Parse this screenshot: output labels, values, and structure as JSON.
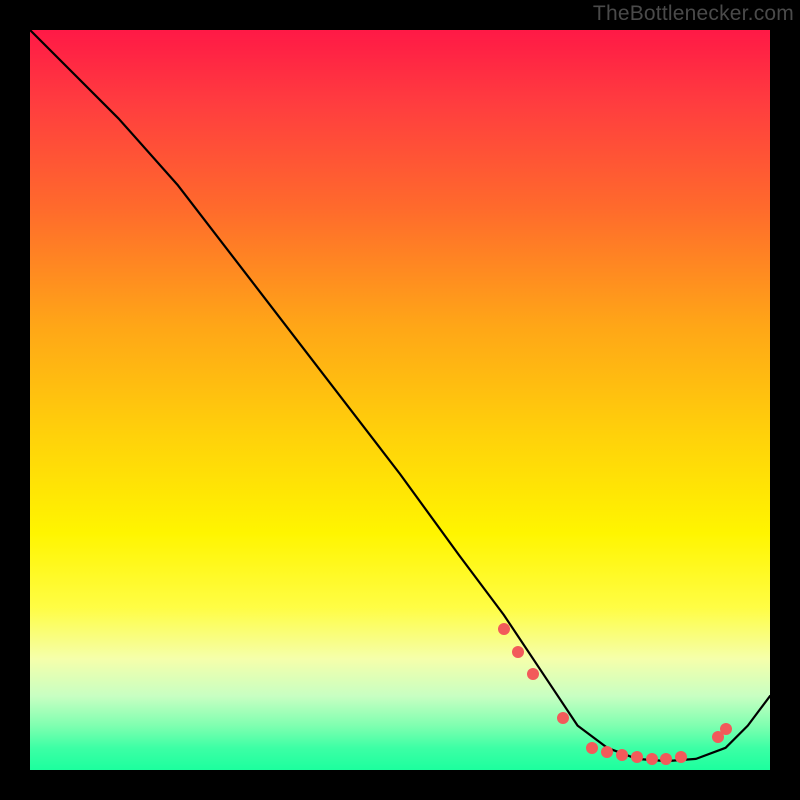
{
  "attribution": "TheBottlenecker.com",
  "chart_data": {
    "type": "line",
    "title": "",
    "xlabel": "",
    "ylabel": "",
    "xlim": [
      0,
      100
    ],
    "ylim": [
      0,
      100
    ],
    "series": [
      {
        "name": "curve",
        "x": [
          0,
          6,
          12,
          20,
          30,
          40,
          50,
          58,
          64,
          70,
          74,
          78,
          82,
          86,
          90,
          94,
          97,
          100
        ],
        "y": [
          100,
          94,
          88,
          79,
          66,
          53,
          40,
          29,
          21,
          12,
          6,
          3,
          1.5,
          1.2,
          1.5,
          3,
          6,
          10
        ]
      }
    ],
    "points": {
      "name": "markers",
      "x": [
        64,
        66,
        68,
        72,
        76,
        78,
        80,
        82,
        84,
        86,
        88,
        93,
        94
      ],
      "y": [
        19,
        16,
        13,
        7,
        3,
        2.5,
        2,
        1.7,
        1.5,
        1.5,
        1.8,
        4.5,
        5.5
      ]
    },
    "colors": {
      "curve": "#000000",
      "marker": "#f25a5a",
      "gradient_top": "#ff1946",
      "gradient_bottom": "#1cff9e"
    }
  }
}
